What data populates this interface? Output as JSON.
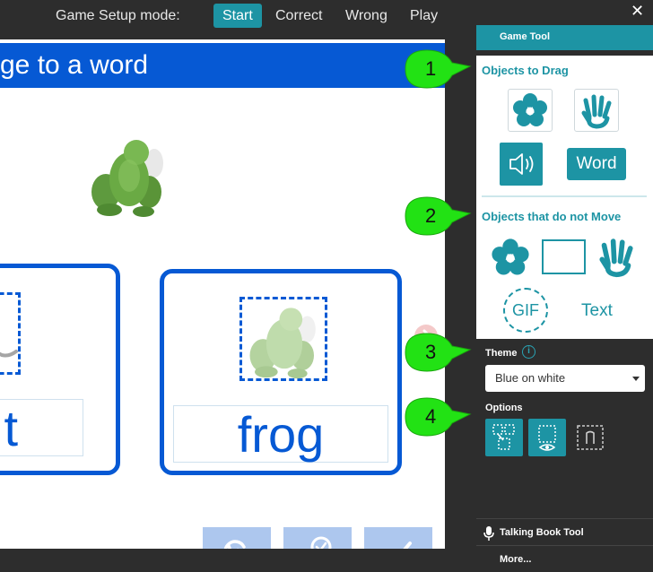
{
  "toolbar": {
    "mode_label": "Game Setup mode:",
    "modes": [
      {
        "label": "Start",
        "active": true
      },
      {
        "label": "Correct",
        "active": false
      },
      {
        "label": "Wrong",
        "active": false
      },
      {
        "label": "Play",
        "active": false
      }
    ]
  },
  "page": {
    "title": "ge to a word",
    "cards": [
      {
        "word": "t"
      },
      {
        "word": "frog"
      }
    ],
    "controls": [
      "undo-icon",
      "check-answer-icon",
      "checkmark-icon"
    ]
  },
  "panel": {
    "close_label": "✕",
    "header": "Game Tool",
    "drag_section": "Objects to Drag",
    "drag_items": [
      "flower-icon",
      "hand-icon",
      "speaker-icon",
      "Word"
    ],
    "static_section": "Objects that do not Move",
    "static_items": [
      "flower-icon",
      "rectangle-icon",
      "hand-icon",
      "GIF",
      "Text"
    ],
    "theme_label": "Theme",
    "theme_value": "Blue on white",
    "options_label": "Options",
    "talking_book": "Talking Book Tool",
    "more": "More..."
  },
  "callouts": [
    "1",
    "2",
    "3",
    "4"
  ],
  "colors": {
    "accent": "#1d94a4",
    "title_blue": "#0659d4",
    "callout_green": "#22e214"
  }
}
